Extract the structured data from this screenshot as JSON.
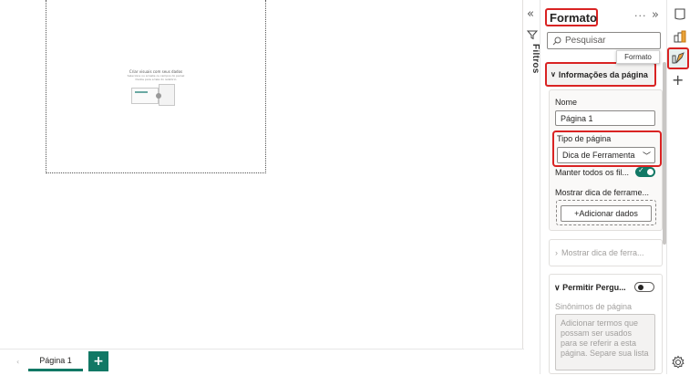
{
  "canvas": {
    "placeholder_title": "Criar visuais com seus dados",
    "placeholder_line1": "Selecione ou arraste os campos do painel",
    "placeholder_line2": "Dados para a tela do relatório"
  },
  "tabs": {
    "page_label": "Página 1",
    "add_label": "+"
  },
  "filters": {
    "label": "Filtros",
    "collapse_glyph": "«"
  },
  "pane": {
    "title": "Formato",
    "more_glyph": "···",
    "expand_glyph": "»",
    "search_placeholder": "Pesquisar",
    "tooltip": "Formato",
    "section_title": "Informações da página",
    "name_label": "Nome",
    "name_value": "Página 1",
    "type_label": "Tipo de página",
    "type_value": "Dica de Ferramenta",
    "keep_filters_label": "Manter todos os fil...",
    "keep_filters_on": true,
    "show_tooltip_label": "Mostrar dica de ferrame...",
    "add_data_label": "+Adicionar dados",
    "collapsed_section": "Mostrar dica de ferra...",
    "qa_title": "Permitir Pergu...",
    "qa_on": false,
    "synonyms_label": "Sinônimos de página",
    "synonyms_placeholder": "Adicionar termos que possam ser usados para se referir a esta página. Separe sua lista"
  },
  "rail": {
    "icons": [
      "bookmark-icon",
      "build-visual-icon",
      "format-visual-icon",
      "add-icon",
      "settings-gear-icon"
    ],
    "plus_glyph": "+"
  },
  "colors": {
    "accent": "#117865",
    "highlight": "#d92323"
  }
}
